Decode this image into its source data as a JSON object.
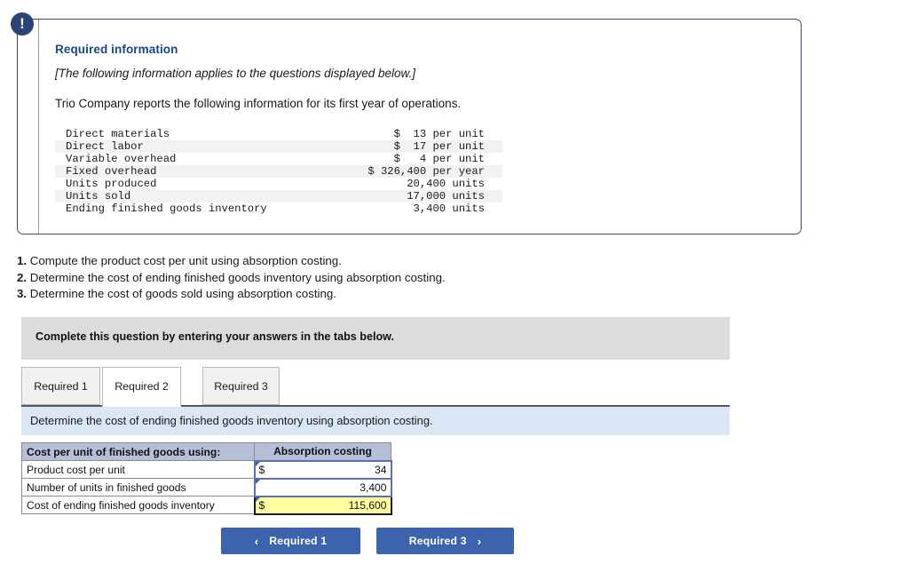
{
  "panel": {
    "icon": "exclamation-icon",
    "title": "Required information",
    "italic_note": "[The following information applies to the questions displayed below.]",
    "lead_text": "Trio Company reports the following information for its first year of operations.",
    "facts": [
      {
        "label": "Direct materials",
        "value": "$  13 per unit"
      },
      {
        "label": "Direct labor",
        "value": "$  17 per unit"
      },
      {
        "label": "Variable overhead",
        "value": "$   4 per unit"
      },
      {
        "label": "Fixed overhead",
        "value": "$ 326,400 per year"
      },
      {
        "label": "Units produced",
        "value": "20,400 units"
      },
      {
        "label": "Units sold",
        "value": "17,000 units"
      },
      {
        "label": "Ending finished goods inventory",
        "value": "3,400 units"
      }
    ]
  },
  "requirements": [
    {
      "num": "1.",
      "text": "Compute the product cost per unit using absorption costing."
    },
    {
      "num": "2.",
      "text": "Determine the cost of ending finished goods inventory using absorption costing."
    },
    {
      "num": "3.",
      "text": "Determine the cost of goods sold using absorption costing."
    }
  ],
  "instruction_bar": {
    "text": "Complete this question by entering your answers in the tabs below."
  },
  "tabs": [
    {
      "label": "Required 1",
      "active": false
    },
    {
      "label": "Required 2",
      "active": true
    },
    {
      "label": "Required 3",
      "active": false
    }
  ],
  "prompt": {
    "text": "Determine the cost of ending finished goods inventory using absorption costing."
  },
  "answer_table": {
    "header_left": "Cost per unit of finished goods using:",
    "header_right": "Absorption costing",
    "rows": [
      {
        "label": "Product cost per unit",
        "currency": "$",
        "value": "34",
        "style": "input"
      },
      {
        "label": "Number of units in finished goods",
        "currency": "",
        "value": "3,400",
        "style": "input"
      },
      {
        "label": "Cost of ending finished goods inventory",
        "currency": "$",
        "value": "115,600",
        "style": "final"
      }
    ]
  },
  "nav": {
    "prev_label": "Required 1",
    "prev_chevron": "‹",
    "next_label": "Required 3",
    "next_chevron": "›"
  },
  "colors": {
    "panel_border": "#3c4a7c",
    "title_blue": "#1c4587",
    "instruction_gray": "#dcdcdc",
    "prompt_blue": "#dbe6f5",
    "table_header": "#b6bfd8",
    "input_border": "#5a72a8",
    "final_fill": "#ffffa0",
    "button_blue": "#3e63ad"
  }
}
